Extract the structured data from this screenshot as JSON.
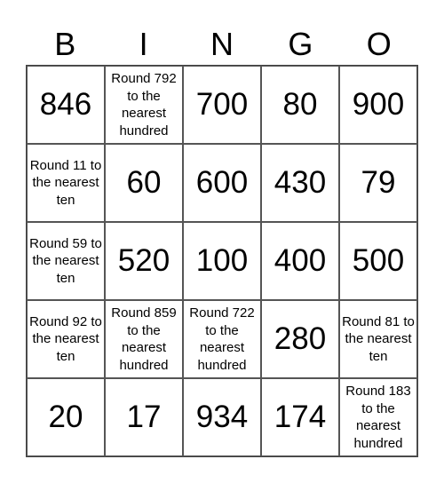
{
  "header": [
    "B",
    "I",
    "N",
    "G",
    "O"
  ],
  "cells": [
    [
      "846",
      "Round 792 to the nearest hundred",
      "700",
      "80",
      "900"
    ],
    [
      "Round 11 to the nearest ten",
      "60",
      "600",
      "430",
      "79"
    ],
    [
      "Round 59 to the nearest ten",
      "520",
      "100",
      "400",
      "500"
    ],
    [
      "Round 92 to the nearest ten",
      "Round 859 to the nearest hundred",
      "Round 722 to the nearest hundred",
      "280",
      "Round 81 to the nearest ten"
    ],
    [
      "20",
      "17",
      "934",
      "174",
      "Round 183 to the nearest hundred"
    ]
  ]
}
